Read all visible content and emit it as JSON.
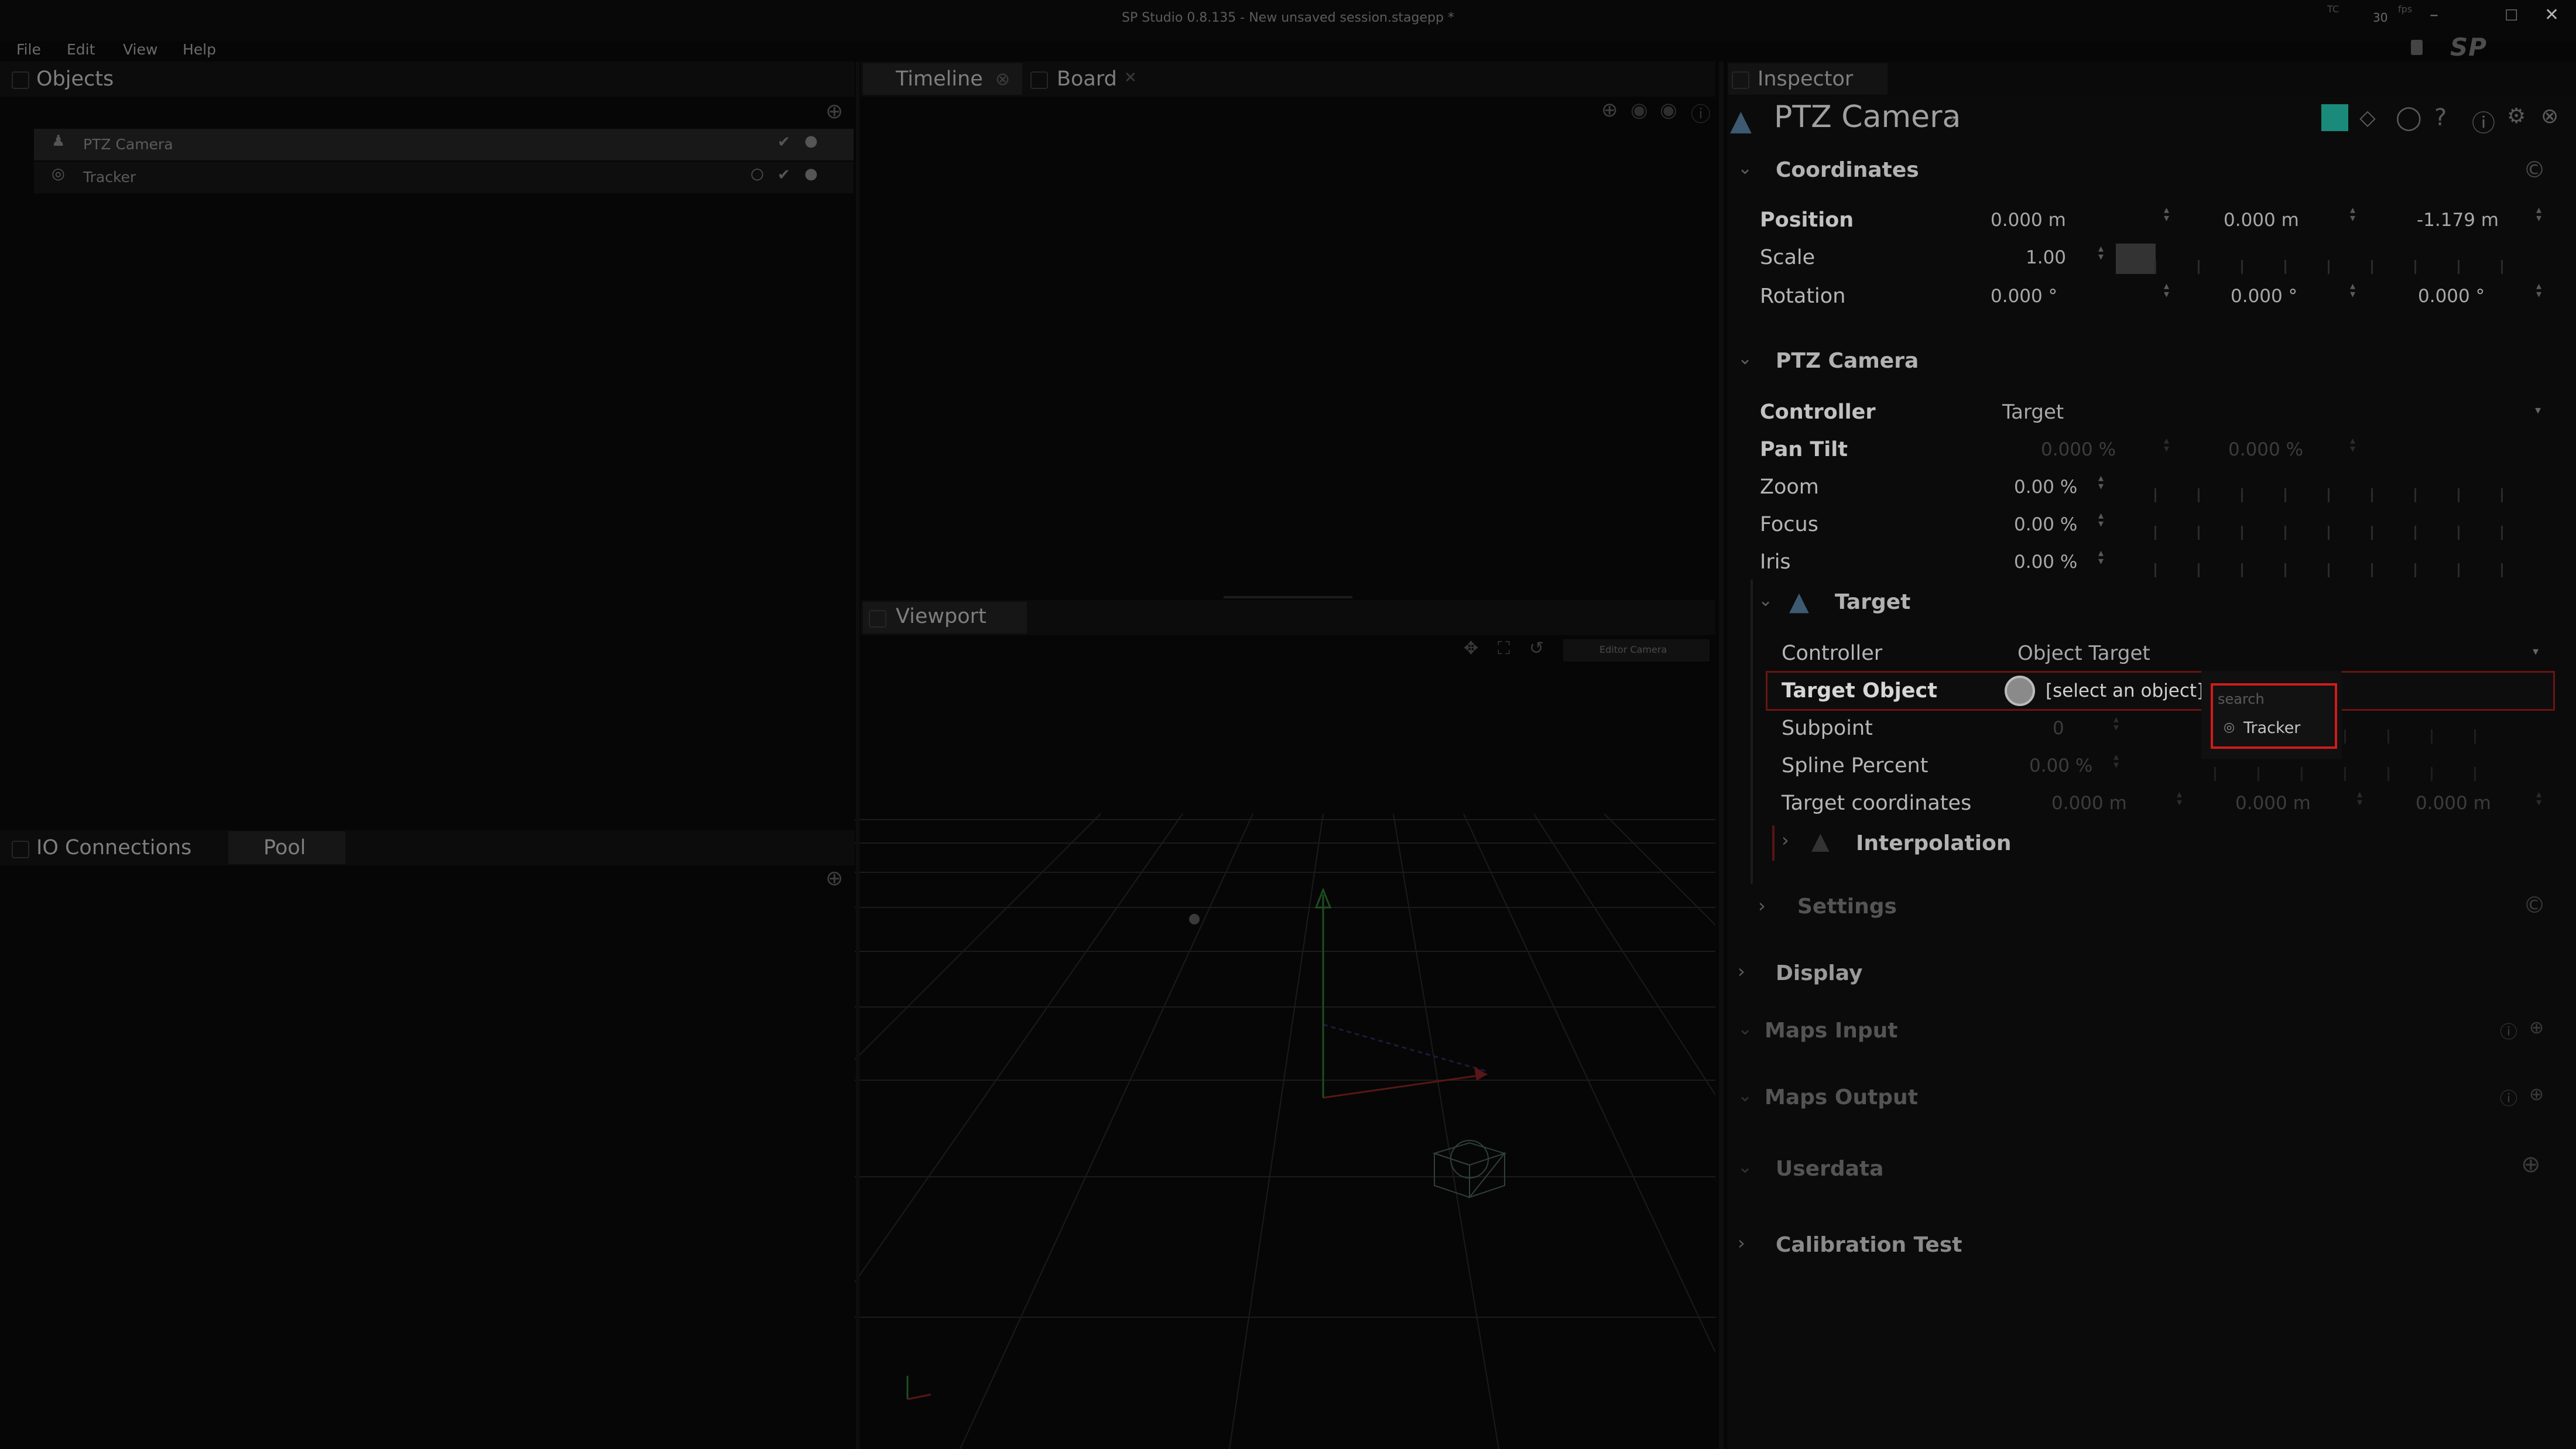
{
  "window": {
    "title": "SP Studio 0.8.135 - New unsaved session.stagepp *",
    "brand": "SP STUDIO",
    "fps_label": "30",
    "tc_label": "TC",
    "fps_unit": "fps",
    "controls": [
      "–",
      "☐",
      "✕"
    ]
  },
  "menu": [
    "File",
    "Edit",
    "View",
    "Help"
  ],
  "objects_panel": {
    "title": "Objects",
    "items": [
      {
        "label": "PTZ Camera",
        "icon": "camera-icon"
      },
      {
        "label": "Tracker",
        "icon": "tracker-icon"
      }
    ]
  },
  "io_panel": {
    "tabs": [
      "IO Connections",
      "Pool"
    ]
  },
  "center_tabs": [
    "Timeline",
    "Board"
  ],
  "viewport": {
    "title": "Viewport",
    "camera_label": "Editor Camera"
  },
  "inspector": {
    "title": "Inspector",
    "object_name": "PTZ Camera",
    "accent": "#1a8a7a",
    "coordinates": {
      "title": "Coordinates",
      "position": {
        "label": "Position",
        "x": "0.000 m",
        "y": "0.000 m",
        "z": "-1.179 m"
      },
      "scale": {
        "label": "Scale",
        "value": "1.00"
      },
      "rotation": {
        "label": "Rotation",
        "x": "0.000 °",
        "y": "0.000 °",
        "z": "0.000 °"
      }
    },
    "ptz": {
      "title": "PTZ Camera",
      "controller": {
        "label": "Controller",
        "value": "Target"
      },
      "pan_tilt": {
        "label": "Pan Tilt",
        "pan": "0.000 %",
        "tilt": "0.000 %"
      },
      "zoom": {
        "label": "Zoom",
        "value": "0.00 %"
      },
      "focus": {
        "label": "Focus",
        "value": "0.00 %"
      },
      "iris": {
        "label": "Iris",
        "value": "0.00 %"
      }
    },
    "target": {
      "title": "Target",
      "controller": {
        "label": "Controller",
        "value": "Object Target"
      },
      "target_object": {
        "label": "Target Object",
        "value": "[select an object]"
      },
      "subpoint": {
        "label": "Subpoint",
        "value": "0"
      },
      "spline_percent": {
        "label": "Spline Percent",
        "value": "0.00 %"
      },
      "target_coordinates": {
        "label": "Target coordinates",
        "x": "0.000 m",
        "y": "0.000 m",
        "z": "0.000 m"
      },
      "interpolation": "Interpolation"
    },
    "sections": [
      "Settings",
      "Display",
      "Maps Input",
      "Maps Output",
      "Userdata",
      "Calibration Test"
    ]
  },
  "search_popup": {
    "placeholder": "search",
    "option": "Tracker"
  }
}
